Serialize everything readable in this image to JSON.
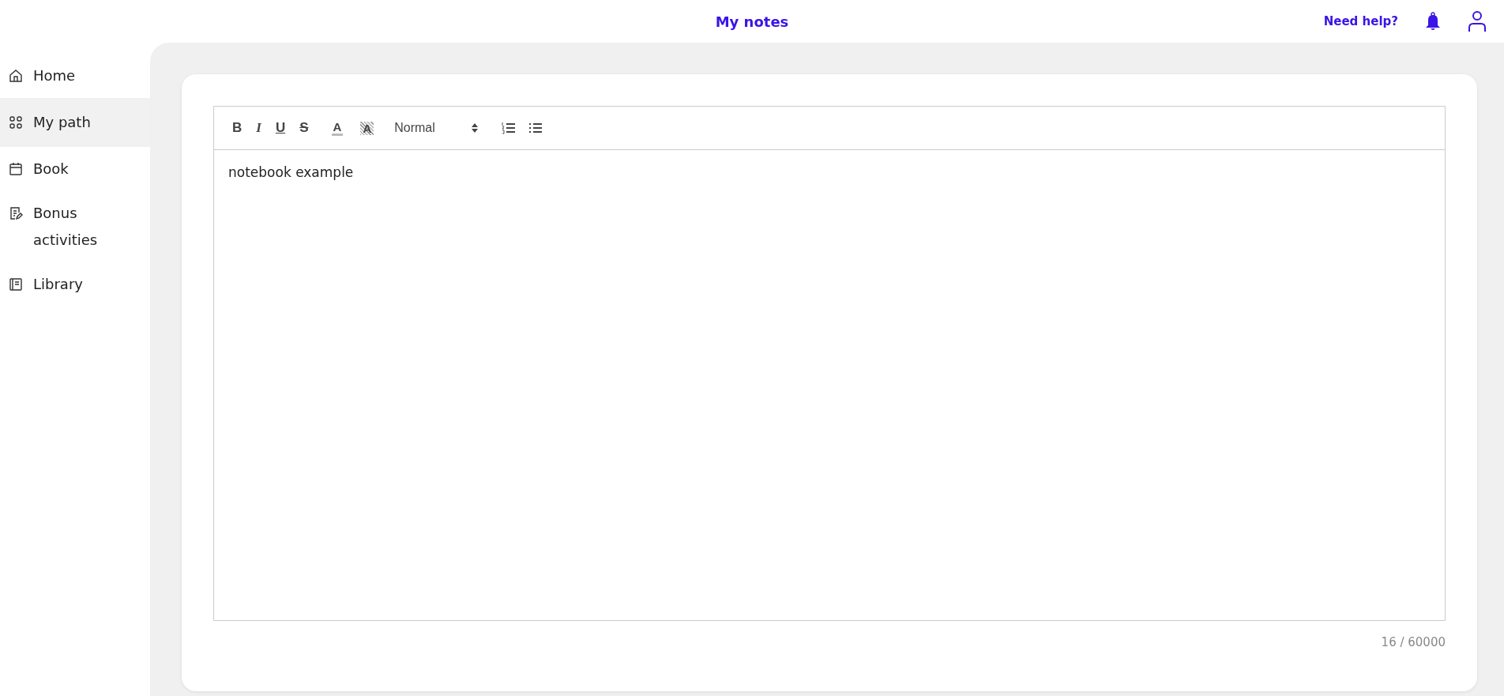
{
  "header": {
    "title": "My notes",
    "help_link": "Need help?"
  },
  "sidebar": {
    "items": [
      {
        "kind": "home",
        "label": "Home",
        "selected": false
      },
      {
        "kind": "path",
        "label": "My path",
        "selected": true
      },
      {
        "kind": "book",
        "label": "Book",
        "selected": false
      },
      {
        "kind": "bonus",
        "label": "Bonus activities",
        "selected": false
      },
      {
        "kind": "library",
        "label": "Library",
        "selected": false
      }
    ]
  },
  "editor": {
    "toolbar": [
      {
        "kind": "bold",
        "label": "B"
      },
      {
        "kind": "italic",
        "label": "I"
      },
      {
        "kind": "underline",
        "label": "U"
      },
      {
        "kind": "strike",
        "label": "S"
      },
      {
        "kind": "color",
        "label": "A"
      },
      {
        "kind": "background",
        "label": "A"
      },
      {
        "kind": "size",
        "label": "Normal"
      },
      {
        "kind": "ordered"
      },
      {
        "kind": "bullet"
      }
    ],
    "content": "notebook example",
    "counter": "16 / 60000"
  }
}
